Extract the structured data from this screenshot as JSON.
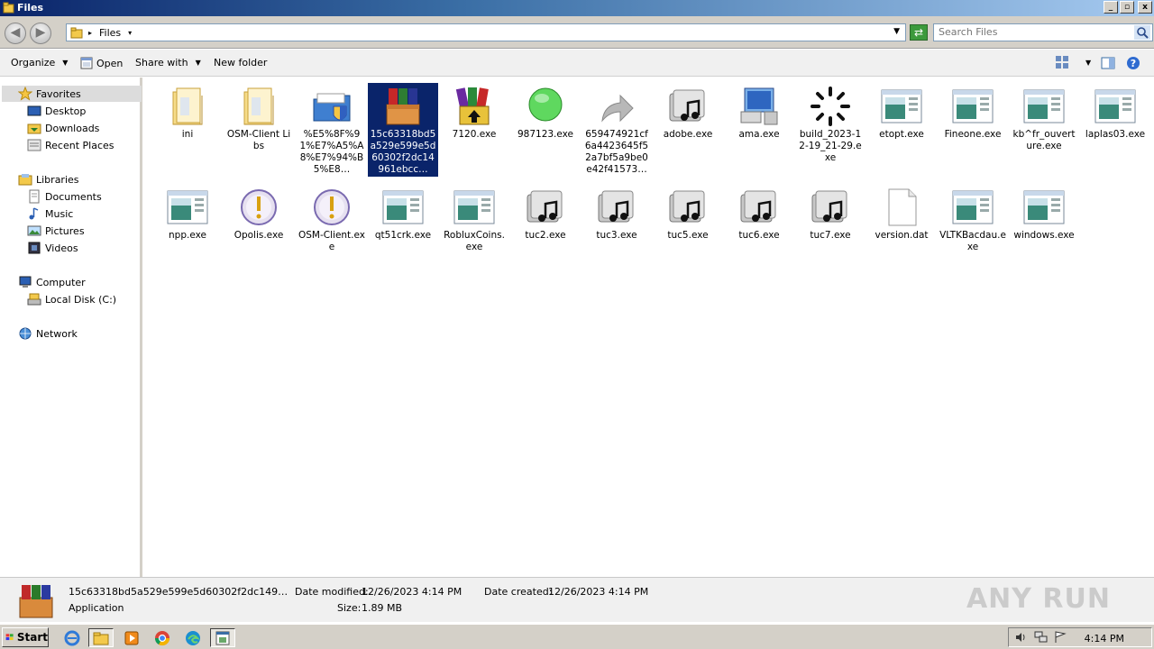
{
  "window": {
    "title": "Files",
    "min": "_",
    "max": "▫",
    "close": "x"
  },
  "address": {
    "location": "Files",
    "search_placeholder": "Search Files"
  },
  "toolbar": {
    "organize": "Organize",
    "open": "Open",
    "share_with": "Share with",
    "new_folder": "New folder"
  },
  "nav": {
    "favorites": "Favorites",
    "desktop": "Desktop",
    "downloads": "Downloads",
    "recent": "Recent Places",
    "libraries": "Libraries",
    "documents": "Documents",
    "music": "Music",
    "pictures": "Pictures",
    "videos": "Videos",
    "computer": "Computer",
    "local_disk": "Local Disk (C:)",
    "network": "Network"
  },
  "files": [
    {
      "name": "ini",
      "icon": "folder-icon"
    },
    {
      "name": "OSM-Client Libs",
      "icon": "folder-icon"
    },
    {
      "name": "%E5%8F%91%E7%A5%A8%E7%94%B5%E8…",
      "icon": "shield-folder-icon"
    },
    {
      "name": "15c63318bd5a529e599e5d60302f2dc14961ebcc…",
      "icon": "winrar-box-icon"
    },
    {
      "name": "7120.exe",
      "icon": "winrar-books-icon"
    },
    {
      "name": "987123.exe",
      "icon": "green-circle-icon"
    },
    {
      "name": "659474921cf6a4423645f52a7bf5a9be0e42f41573…",
      "icon": "shortcut-arrow-icon"
    },
    {
      "name": "adobe.exe",
      "icon": "music-drive-icon"
    },
    {
      "name": "ama.exe",
      "icon": "computer-icon"
    },
    {
      "name": "build_2023-12-19_21-29.exe",
      "icon": "spinner-icon"
    },
    {
      "name": "etopt.exe",
      "icon": "app-window-icon"
    },
    {
      "name": "Fineone.exe",
      "icon": "app-window-icon"
    },
    {
      "name": "kb^fr_ouverture.exe",
      "icon": "app-window-icon"
    },
    {
      "name": "laplas03.exe",
      "icon": "app-window-icon"
    },
    {
      "name": "npp.exe",
      "icon": "app-window-icon"
    },
    {
      "name": "Opolis.exe",
      "icon": "warning-circle-icon"
    },
    {
      "name": "OSM-Client.exe",
      "icon": "warning-circle-icon"
    },
    {
      "name": "qt51crk.exe",
      "icon": "app-window-icon"
    },
    {
      "name": "RobluxCoins.exe",
      "icon": "app-window-icon"
    },
    {
      "name": "tuc2.exe",
      "icon": "music-drive-icon"
    },
    {
      "name": "tuc3.exe",
      "icon": "music-drive-icon"
    },
    {
      "name": "tuc5.exe",
      "icon": "music-drive-icon"
    },
    {
      "name": "tuc6.exe",
      "icon": "music-drive-icon"
    },
    {
      "name": "tuc7.exe",
      "icon": "music-drive-icon"
    },
    {
      "name": "version.dat",
      "icon": "blank-document-icon"
    },
    {
      "name": "VLTKBacdau.exe",
      "icon": "app-window-icon"
    },
    {
      "name": "windows.exe",
      "icon": "app-window-icon"
    }
  ],
  "details": {
    "name": "15c63318bd5a529e599e5d60302f2dc149…",
    "type": "Application",
    "modified_label": "Date modified:",
    "modified_value": "12/26/2023 4:14 PM",
    "created_label": "Date created:",
    "created_value": "12/26/2023 4:14 PM",
    "size_label": "Size:",
    "size_value": "1.89 MB"
  },
  "watermark": "ANY RUN",
  "taskbar": {
    "start": "Start",
    "clock": "4:14 PM"
  }
}
